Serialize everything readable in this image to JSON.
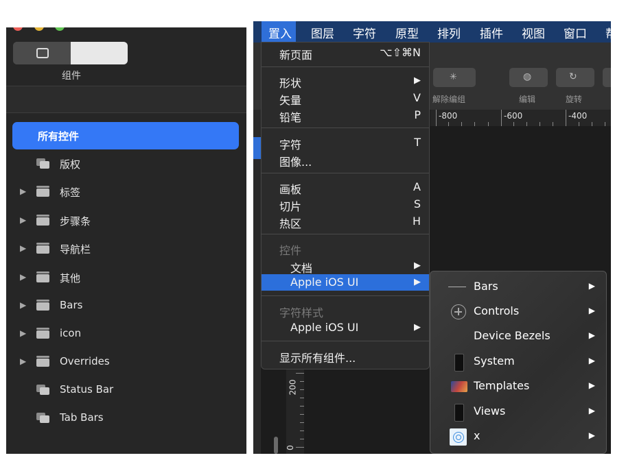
{
  "library": {
    "segment_label": "组件",
    "selected_item": "所有控件",
    "items": [
      {
        "label": "版权",
        "expandable": false
      },
      {
        "label": "标签",
        "expandable": true
      },
      {
        "label": "步骤条",
        "expandable": true
      },
      {
        "label": "导航栏",
        "expandable": true
      },
      {
        "label": "其他",
        "expandable": true
      },
      {
        "label": "Bars",
        "expandable": true
      },
      {
        "label": "icon",
        "expandable": true
      },
      {
        "label": "Overrides",
        "expandable": true
      },
      {
        "label": "Status Bar",
        "expandable": false
      },
      {
        "label": "Tab Bars",
        "expandable": false
      }
    ]
  },
  "menubar": {
    "items": [
      "置入",
      "图层",
      "字符",
      "原型",
      "排列",
      "插件",
      "视图",
      "窗口",
      "帮"
    ],
    "active": "置入"
  },
  "toolbar": {
    "labels": [
      "解除编组",
      "编辑",
      "旋转"
    ]
  },
  "ruler": {
    "marks": [
      "-800",
      "-600",
      "-400"
    ]
  },
  "vruler": {
    "marks": [
      "200",
      "0"
    ]
  },
  "menu": {
    "new_page": {
      "label": "新页面",
      "shortcut": "⌥⇧⌘N"
    },
    "shape": {
      "label": "形状",
      "arrow": "▶"
    },
    "vector": {
      "label": "矢量",
      "shortcut": "V"
    },
    "pencil": {
      "label": "铅笔",
      "shortcut": "P"
    },
    "text": {
      "label": "字符",
      "shortcut": "T"
    },
    "image": {
      "label": "图像..."
    },
    "artboard": {
      "label": "画板",
      "shortcut": "A"
    },
    "slice": {
      "label": "切片",
      "shortcut": "S"
    },
    "hotspot": {
      "label": "热区",
      "shortcut": "H"
    },
    "components_header": "控件",
    "document": {
      "label": "文档",
      "arrow": "▶"
    },
    "apple_ios_ui": {
      "label": "Apple iOS UI",
      "arrow": "▶"
    },
    "text_styles_header": "字符样式",
    "text_styles_ios": {
      "label": "Apple iOS UI",
      "arrow": "▶"
    },
    "show_all": {
      "label": "显示所有组件..."
    }
  },
  "submenu": {
    "items": [
      {
        "label": "Bars",
        "icon": "line-icon"
      },
      {
        "label": "Controls",
        "icon": "plus-circle-icon"
      },
      {
        "label": "Device Bezels",
        "icon": "none"
      },
      {
        "label": "System",
        "icon": "phone-icon"
      },
      {
        "label": "Templates",
        "icon": "template-thumbnail-icon"
      },
      {
        "label": "Views",
        "icon": "phone-icon"
      },
      {
        "label": "x",
        "icon": "airdrop-icon"
      }
    ],
    "arrow": "▶"
  },
  "colors": {
    "selection": "#3478f6",
    "menu_highlight": "#2c6fdb"
  }
}
